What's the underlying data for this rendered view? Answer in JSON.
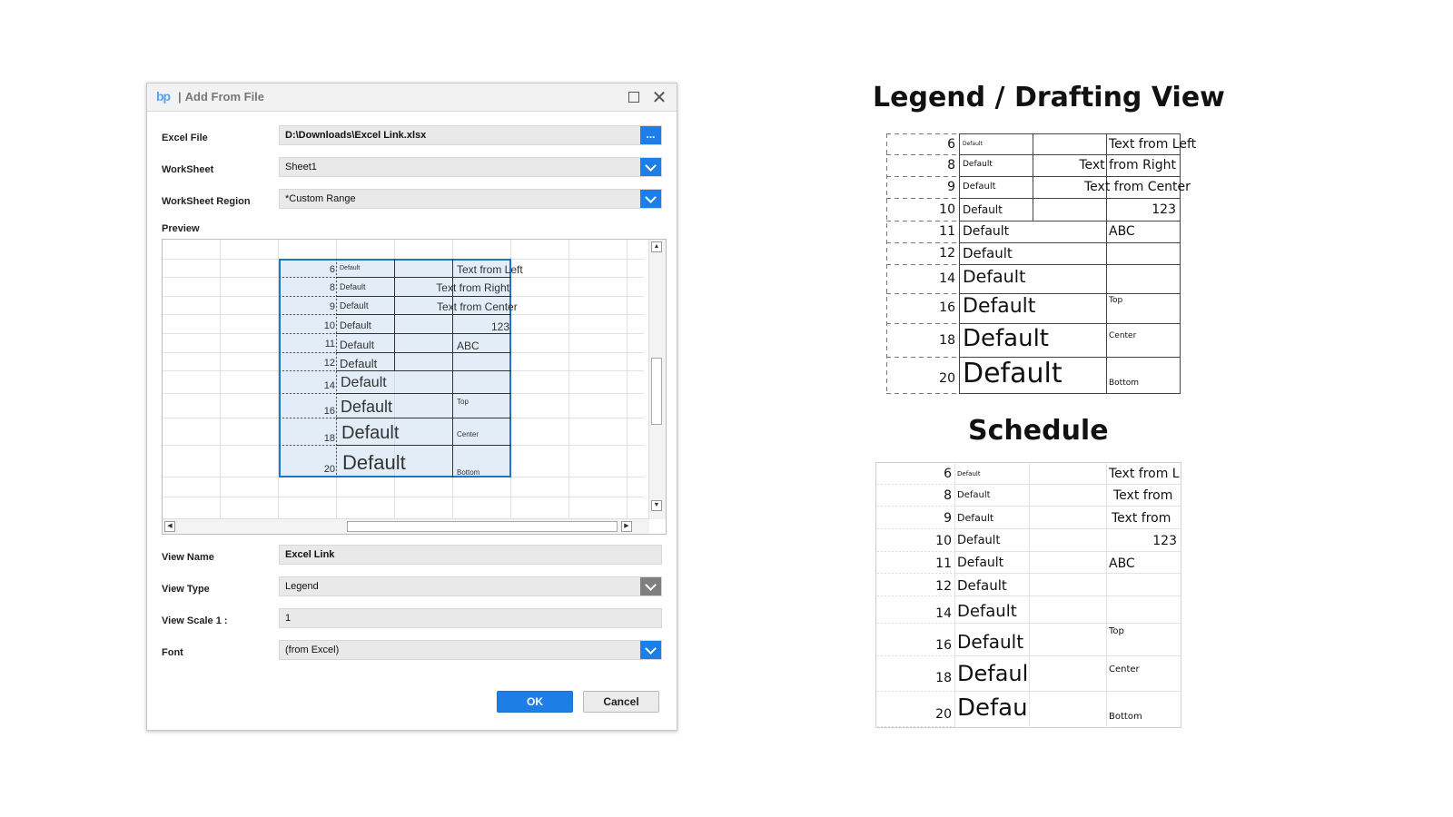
{
  "dialog": {
    "title": "Add From File",
    "title_separator": "|",
    "logo_text": "bp",
    "fields": {
      "excel_file_label": "Excel File",
      "excel_file_value": "D:\\Downloads\\Excel Link.xlsx",
      "browse_label": "...",
      "worksheet_label": "WorkSheet",
      "worksheet_value": "Sheet1",
      "region_label": "WorkSheet Region",
      "region_value": "*Custom Range",
      "preview_label": "Preview",
      "view_name_label": "View Name",
      "view_name_value": "Excel Link",
      "view_type_label": "View Type",
      "view_type_value": "Legend",
      "view_scale_label": "View Scale 1 :",
      "view_scale_value": "1",
      "font_label": "Font",
      "font_value": "(from Excel)"
    },
    "buttons": {
      "ok": "OK",
      "cancel": "Cancel"
    },
    "icons": {
      "maximize": "maximize-icon",
      "close": "close-icon",
      "dropdown": "chevron-down-icon"
    },
    "colors": {
      "accent": "#1e7ee8",
      "selection_border": "#1e74c8"
    }
  },
  "preview_rows": [
    {
      "num": "6",
      "font": "Default",
      "col3": "Text from Left"
    },
    {
      "num": "8",
      "font": "Default",
      "col2": "Text from Right"
    },
    {
      "num": "9",
      "font": "Default",
      "col2": "Text from Center"
    },
    {
      "num": "10",
      "font": "Default",
      "col3": "123"
    },
    {
      "num": "11",
      "font": "Default",
      "col3": "ABC"
    },
    {
      "num": "12",
      "font": "Default"
    },
    {
      "num": "14",
      "font": "Default"
    },
    {
      "num": "16",
      "font": "Default",
      "col3": "Top"
    },
    {
      "num": "18",
      "font": "Default",
      "col3": "Center"
    },
    {
      "num": "20",
      "font": "Default",
      "col3": "Bottom"
    }
  ],
  "legend_view": {
    "title": "Legend / Drafting View",
    "rows": [
      {
        "num": "6",
        "font": "Default",
        "col3": "Text from Left"
      },
      {
        "num": "8",
        "font": "Default",
        "col2": "Text from Right"
      },
      {
        "num": "9",
        "font": "Default",
        "col2": "Text from Center"
      },
      {
        "num": "10",
        "font": "Default",
        "col3": "123"
      },
      {
        "num": "11",
        "font": "Default",
        "col3": "ABC"
      },
      {
        "num": "12",
        "font": "Default"
      },
      {
        "num": "14",
        "font": "Default"
      },
      {
        "num": "16",
        "font": "Default",
        "col3": "Top"
      },
      {
        "num": "18",
        "font": "Default",
        "col3": "Center"
      },
      {
        "num": "20",
        "font": "Default",
        "col3": "Bottom"
      }
    ]
  },
  "schedule_view": {
    "title": "Schedule",
    "rows": [
      {
        "num": "6",
        "font": "Default",
        "col3": "Text from L"
      },
      {
        "num": "8",
        "font": "Default",
        "col3": "Text from"
      },
      {
        "num": "9",
        "font": "Default",
        "col3": "Text from"
      },
      {
        "num": "10",
        "font": "Default",
        "col3": "123"
      },
      {
        "num": "11",
        "font": "Default",
        "col3": "ABC"
      },
      {
        "num": "12",
        "font": "Default"
      },
      {
        "num": "14",
        "font": "Default"
      },
      {
        "num": "16",
        "font": "Default",
        "col3": "Top"
      },
      {
        "num": "18",
        "font": "Defaul",
        "col3": "Center"
      },
      {
        "num": "20",
        "font": "Defau",
        "col3": "Bottom"
      }
    ]
  }
}
